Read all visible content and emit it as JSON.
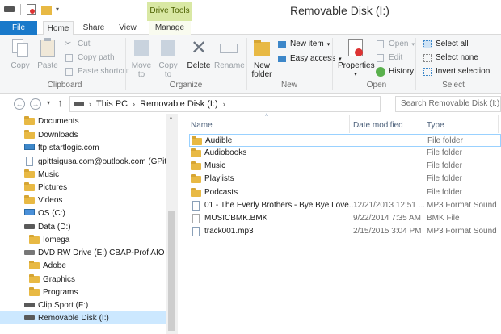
{
  "window": {
    "title": "Removable Disk (I:)",
    "context_group": "Drive Tools"
  },
  "tabs": {
    "file": "File",
    "home": "Home",
    "share": "Share",
    "view": "View",
    "manage": "Manage"
  },
  "ribbon": {
    "clipboard": {
      "label": "Clipboard",
      "copy": "Copy",
      "paste": "Paste",
      "cut": "Cut",
      "copy_path": "Copy path",
      "paste_shortcut": "Paste shortcut"
    },
    "organize": {
      "label": "Organize",
      "move_to_1": "Move",
      "move_to_2": "to",
      "copy_to_1": "Copy",
      "copy_to_2": "to",
      "delete": "Delete",
      "rename": "Rename"
    },
    "new": {
      "label": "New",
      "new_folder_1": "New",
      "new_folder_2": "folder",
      "new_item": "New item",
      "easy_access": "Easy access"
    },
    "open": {
      "label": "Open",
      "properties": "Properties",
      "open": "Open",
      "edit": "Edit",
      "history": "History"
    },
    "select": {
      "label": "Select",
      "select_all": "Select all",
      "select_none": "Select none",
      "invert_selection": "Invert selection"
    }
  },
  "address": {
    "crumbs": [
      "This PC",
      "Removable Disk (I:)"
    ],
    "search_placeholder": "Search Removable Disk (I:)"
  },
  "nav_pane": {
    "items": [
      {
        "label": "Documents",
        "icon": "folder-icon"
      },
      {
        "label": "Downloads",
        "icon": "folder-icon"
      },
      {
        "label": "ftp.startlogic.com",
        "icon": "network-icon"
      },
      {
        "label": "gpittsigusa.com@outlook.com (GPitts)",
        "icon": "onedrive-icon"
      },
      {
        "label": "Music",
        "icon": "folder-icon"
      },
      {
        "label": "Pictures",
        "icon": "folder-icon"
      },
      {
        "label": "Videos",
        "icon": "folder-icon"
      },
      {
        "label": "OS (C:)",
        "icon": "drive-icon"
      },
      {
        "label": "Data (D:)",
        "icon": "drive-icon"
      },
      {
        "label": "Iomega",
        "icon": "folder-icon"
      },
      {
        "label": "DVD RW Drive (E:) CBAP-Prof AIO",
        "icon": "dvd-icon"
      },
      {
        "label": "Adobe",
        "icon": "folder-icon"
      },
      {
        "label": "Graphics",
        "icon": "folder-icon"
      },
      {
        "label": "Programs",
        "icon": "folder-icon"
      },
      {
        "label": "Clip Sport (F:)",
        "icon": "drive-icon"
      },
      {
        "label": "Removable Disk (I:)",
        "icon": "drive-icon"
      }
    ]
  },
  "file_list": {
    "columns": {
      "name": "Name",
      "date": "Date modified",
      "type": "Type"
    },
    "rows": [
      {
        "name": "Audible",
        "date": "",
        "type": "File folder",
        "icon": "folder-icon"
      },
      {
        "name": "Audiobooks",
        "date": "",
        "type": "File folder",
        "icon": "folder-icon"
      },
      {
        "name": "Music",
        "date": "",
        "type": "File folder",
        "icon": "folder-icon"
      },
      {
        "name": "Playlists",
        "date": "",
        "type": "File folder",
        "icon": "folder-icon"
      },
      {
        "name": "Podcasts",
        "date": "",
        "type": "File folder",
        "icon": "folder-icon"
      },
      {
        "name": "01 - The Everly Brothers - Bye Bye Love....",
        "date": "12/21/2013 12:51 ...",
        "type": "MP3 Format Sound",
        "icon": "audio-file-icon"
      },
      {
        "name": "MUSICBMK.BMK",
        "date": "9/22/2014 7:35 AM",
        "type": "BMK File",
        "icon": "file-icon"
      },
      {
        "name": "track001.mp3",
        "date": "2/15/2015 3:04 PM",
        "type": "MP3 Format Sound",
        "icon": "audio-file-icon"
      }
    ]
  },
  "colors": {
    "file_tab": "#1979ca",
    "drive_tools": "#d9e8a4",
    "folder": "#e8b944",
    "selection": "#cce8ff",
    "hover_border": "#99d1ff"
  }
}
